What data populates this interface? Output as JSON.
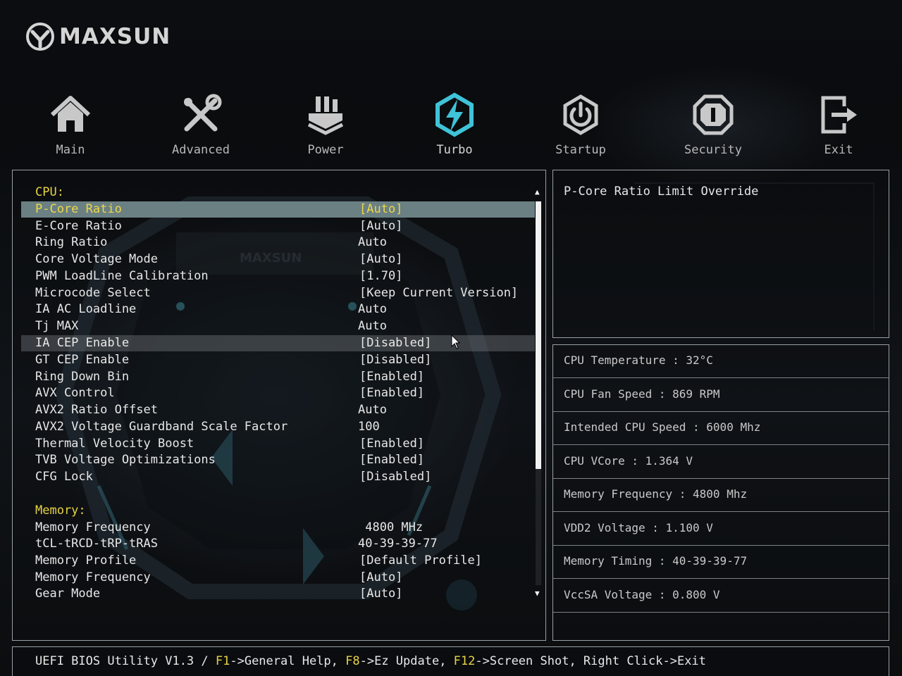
{
  "brand": {
    "name": "MAXSUN"
  },
  "colors": {
    "accent": "#e8d445",
    "selected_row": "#6b8083",
    "turbo_icon": "#3fc3d8",
    "border": "#9aa0a6"
  },
  "nav": {
    "active": "Turbo",
    "tabs": [
      {
        "label": "Main",
        "icon": "home-icon"
      },
      {
        "label": "Advanced",
        "icon": "tools-icon"
      },
      {
        "label": "Power",
        "icon": "power-plug-icon"
      },
      {
        "label": "Turbo",
        "icon": "turbo-bolt-icon"
      },
      {
        "label": "Startup",
        "icon": "power-button-icon"
      },
      {
        "label": "Security",
        "icon": "security-shield-icon"
      },
      {
        "label": "Exit",
        "icon": "exit-icon"
      }
    ]
  },
  "settings": {
    "cpu_header": "CPU:",
    "memory_header": "Memory:",
    "cpu_items": [
      {
        "label": "P-Core Ratio",
        "value": "[Auto]"
      },
      {
        "label": "E-Core Ratio",
        "value": "[Auto]"
      },
      {
        "label": "Ring Ratio",
        "value": "Auto"
      },
      {
        "label": "Core Voltage Mode",
        "value": "[Auto]"
      },
      {
        "label": "PWM LoadLine Calibration",
        "value": "[1.70]"
      },
      {
        "label": "Microcode Select",
        "value": "[Keep Current Version]"
      },
      {
        "label": "IA AC Loadline",
        "value": "Auto"
      },
      {
        "label": "Tj MAX",
        "value": "Auto"
      },
      {
        "label": "IA CEP Enable",
        "value": "[Disabled]"
      },
      {
        "label": "GT CEP Enable",
        "value": "[Disabled]"
      },
      {
        "label": "Ring Down Bin",
        "value": "[Enabled]"
      },
      {
        "label": "AVX Control",
        "value": "[Enabled]"
      },
      {
        "label": "AVX2 Ratio Offset",
        "value": "Auto"
      },
      {
        "label": "AVX2 Voltage Guardband Scale Factor",
        "value": "100"
      },
      {
        "label": "Thermal Velocity Boost",
        "value": "[Enabled]"
      },
      {
        "label": "TVB Voltage Optimizations",
        "value": "[Enabled]"
      },
      {
        "label": "CFG Lock",
        "value": "[Disabled]"
      }
    ],
    "memory_items": [
      {
        "label": "Memory Frequency",
        "value": " 4800 MHz"
      },
      {
        "label": "tCL-tRCD-tRP-tRAS",
        "value": "40-39-39-77"
      },
      {
        "label": "Memory Profile",
        "value": "[Default Profile]"
      },
      {
        "label": "Memory Frequency",
        "value": "[Auto]"
      },
      {
        "label": "Gear Mode",
        "value": "[Auto]"
      }
    ]
  },
  "help": {
    "text": "P-Core Ratio Limit Override"
  },
  "status": [
    "CPU Temperature : 32°C",
    "CPU Fan Speed : 869 RPM",
    "Intended CPU Speed : 6000 Mhz",
    "CPU VCore : 1.364 V",
    "Memory Frequency : 4800 Mhz",
    "VDD2 Voltage : 1.100 V",
    "Memory Timing : 40-39-39-77",
    "VccSA Voltage : 0.800 V"
  ],
  "footer": {
    "prefix": "UEFI BIOS Utility V1.3 / ",
    "k1": "F1",
    "t1": "->General Help, ",
    "k2": "F8",
    "t2": "->Ez Update, ",
    "k3": "F12",
    "t3": "->Screen Shot, Right Click->Exit"
  }
}
